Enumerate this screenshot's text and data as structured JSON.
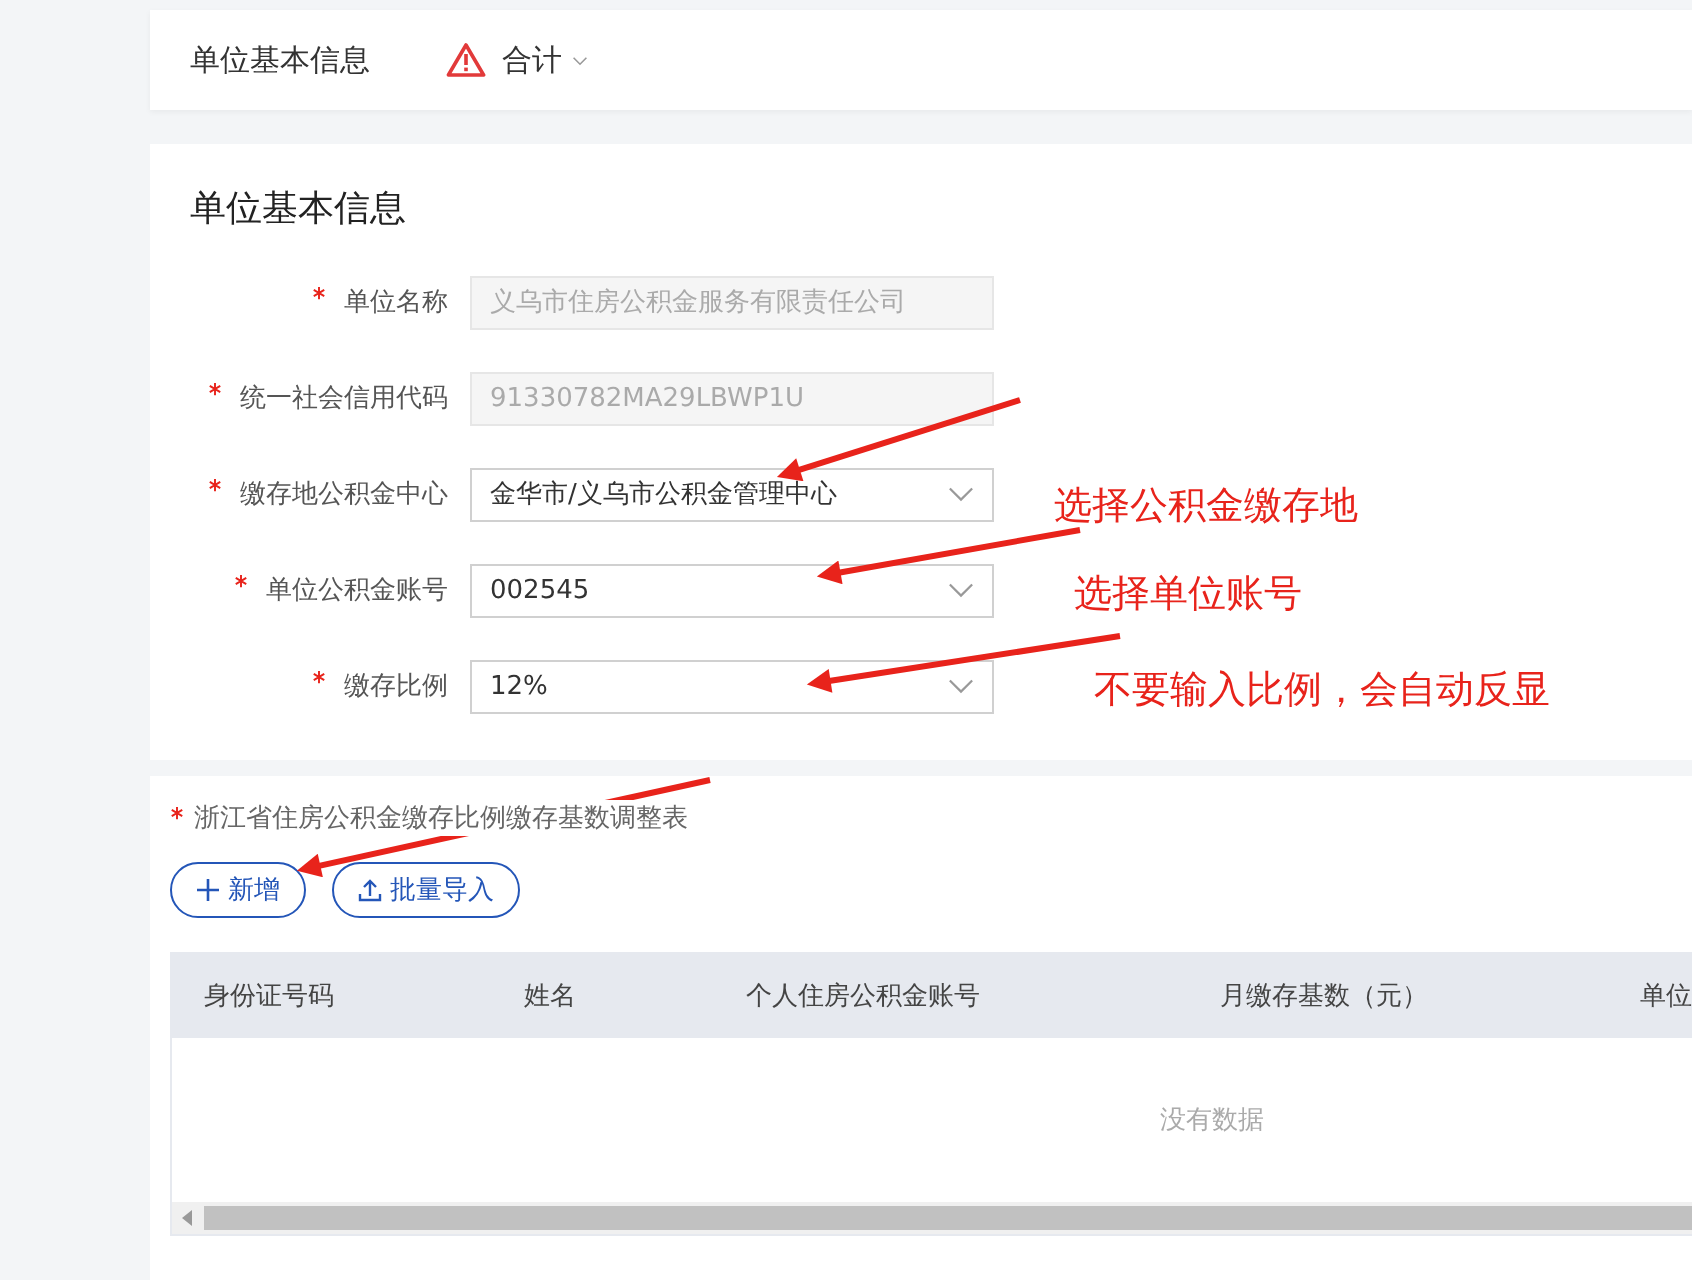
{
  "header": {
    "title": "单位基本信息",
    "status": {
      "kind": "warning",
      "label": "合计"
    }
  },
  "form": {
    "title": "单位基本信息",
    "fields": [
      {
        "label": "单位名称",
        "required": true,
        "kind": "text",
        "value": "义乌市住房公积金服务有限责任公司",
        "disabled": true
      },
      {
        "label": "统一社会信用代码",
        "required": true,
        "kind": "text",
        "value": "91330782MA29LBWP1U",
        "disabled": true
      },
      {
        "label": "缴存地公积金中心",
        "required": true,
        "kind": "select",
        "value": "金华市/义乌市公积金管理中心",
        "disabled": false
      },
      {
        "label": "单位公积金账号",
        "required": true,
        "kind": "select",
        "value": "002545",
        "disabled": false
      },
      {
        "label": "缴存比例",
        "required": true,
        "kind": "select",
        "value": "12%",
        "disabled": false
      }
    ]
  },
  "table_section": {
    "title": "浙江省住房公积金缴存比例缴存基数调整表",
    "required": true,
    "buttons": [
      {
        "kind": "add",
        "label": "新增"
      },
      {
        "kind": "import",
        "label": "批量导入"
      }
    ],
    "columns": [
      "身份证号码",
      "姓名",
      "个人住房公积金账号",
      "月缴存基数（元）",
      "单位"
    ],
    "empty_text": "没有数据"
  },
  "annotations": [
    "选择公积金缴存地",
    "选择单位账号",
    "不要输入比例，会自动反显"
  ]
}
